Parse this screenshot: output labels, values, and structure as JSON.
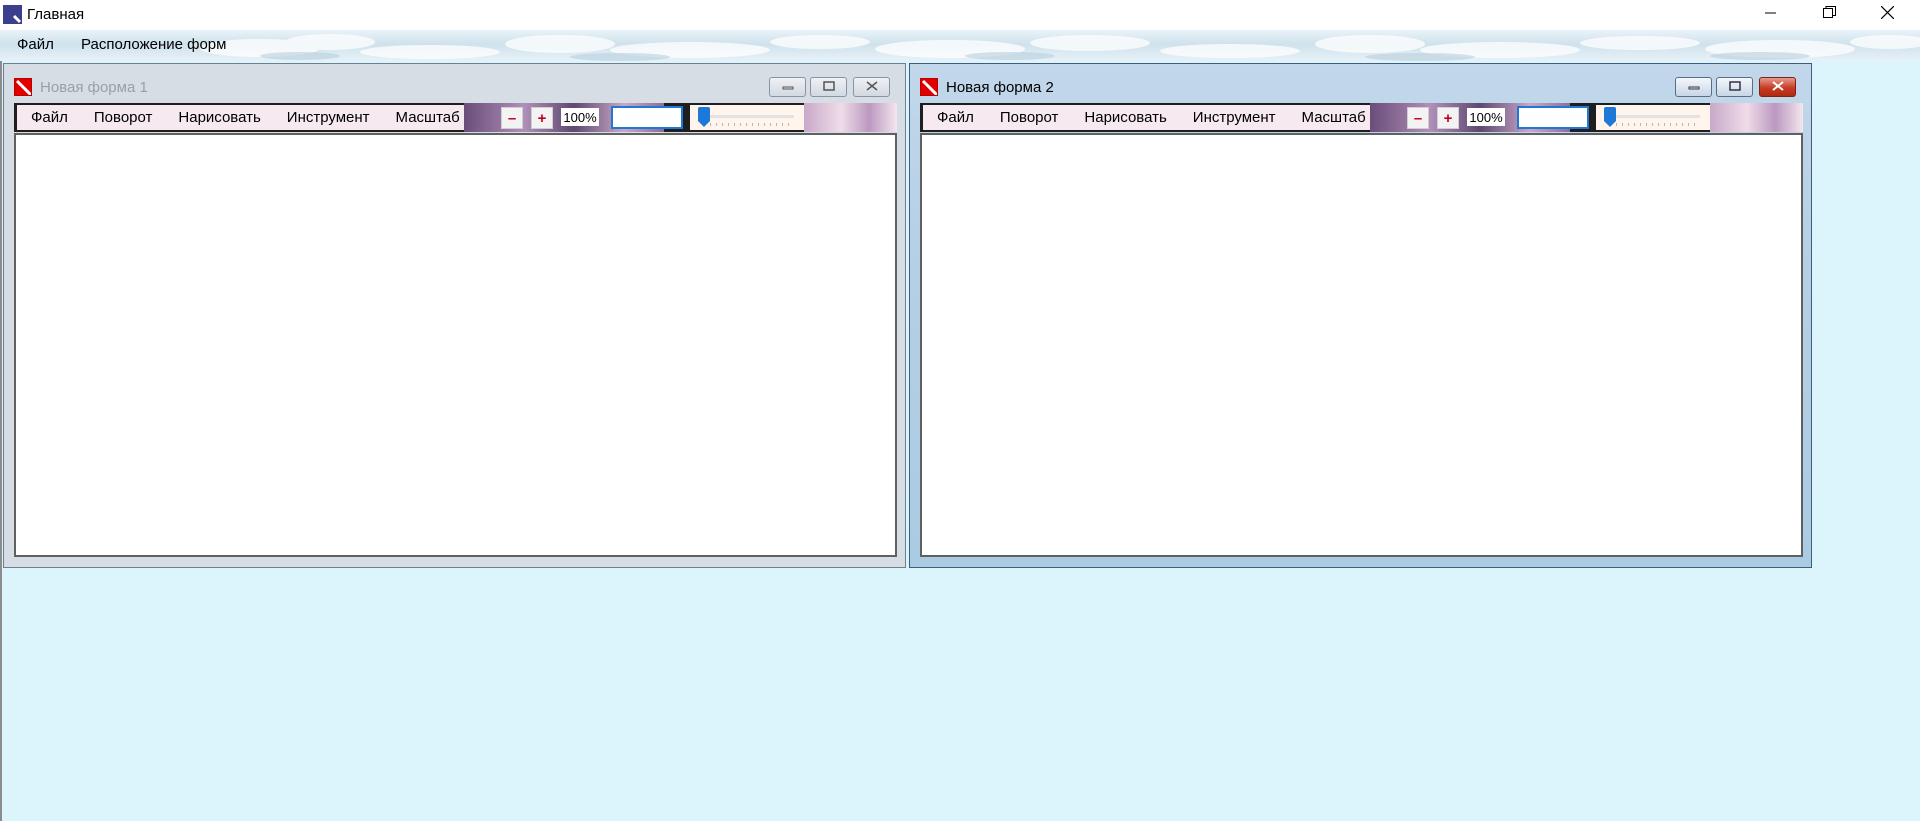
{
  "window": {
    "title": "Главная",
    "controls": {
      "minimize": "minimize-icon",
      "restore": "restore-icon",
      "close": "close-icon"
    }
  },
  "menubar": {
    "items": [
      {
        "label": "Файл"
      },
      {
        "label": "Расположение форм"
      }
    ]
  },
  "forms": [
    {
      "title": "Новая форма 1",
      "state": "inactive",
      "menu": [
        "Файл",
        "Поворот",
        "Нарисовать",
        "Инструмент",
        "Масштаб"
      ],
      "zoom_out": "–",
      "zoom_in": "+",
      "zoom_value": "100%",
      "zoom_input": "",
      "slider_level": 0
    },
    {
      "title": "Новая форма 2",
      "state": "active",
      "menu": [
        "Файл",
        "Поворот",
        "Нарисовать",
        "Инструмент",
        "Масштаб"
      ],
      "zoom_out": "–",
      "zoom_in": "+",
      "zoom_value": "100%",
      "zoom_input": "",
      "slider_level": 0
    }
  ],
  "colors": {
    "workspace": "#dcf5fc",
    "input_border": "#1e78d7",
    "close_red": "#c63b22"
  }
}
